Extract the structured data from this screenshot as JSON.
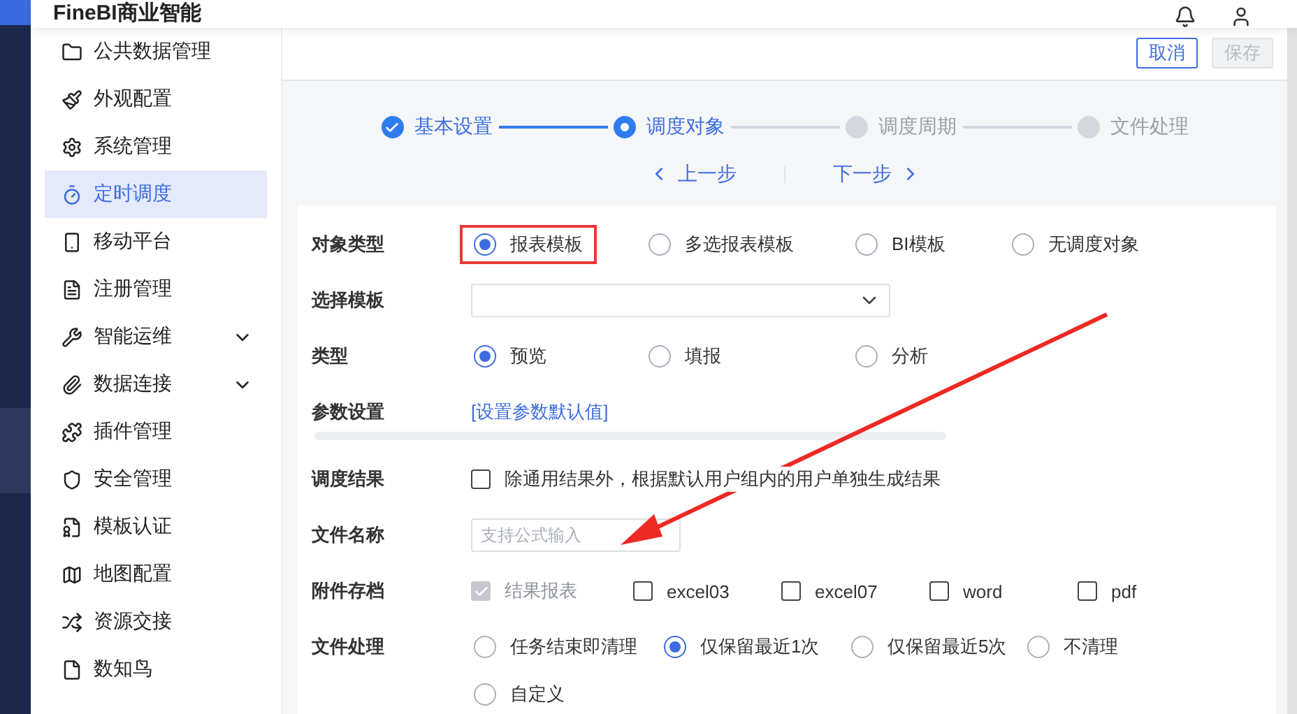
{
  "header": {
    "title": "FineBI商业智能"
  },
  "rail": [
    {
      "selected": false
    },
    {
      "selected": false
    },
    {
      "selected": true
    },
    {
      "selected": false
    },
    {
      "selected": false
    }
  ],
  "sidebar": {
    "items": [
      {
        "label": "公共数据管理",
        "selected": false,
        "expandable": false
      },
      {
        "label": "外观配置",
        "selected": false,
        "expandable": false
      },
      {
        "label": "系统管理",
        "selected": false,
        "expandable": false
      },
      {
        "label": "定时调度",
        "selected": true,
        "expandable": false
      },
      {
        "label": "移动平台",
        "selected": false,
        "expandable": false
      },
      {
        "label": "注册管理",
        "selected": false,
        "expandable": false
      },
      {
        "label": "智能运维",
        "selected": false,
        "expandable": true
      },
      {
        "label": "数据连接",
        "selected": false,
        "expandable": true
      },
      {
        "label": "插件管理",
        "selected": false,
        "expandable": false
      },
      {
        "label": "安全管理",
        "selected": false,
        "expandable": false
      },
      {
        "label": "模板认证",
        "selected": false,
        "expandable": false
      },
      {
        "label": "地图配置",
        "selected": false,
        "expandable": false
      },
      {
        "label": "资源交接",
        "selected": false,
        "expandable": false
      },
      {
        "label": "数知鸟",
        "selected": false,
        "expandable": false
      }
    ]
  },
  "toolbar": {
    "buttons": [
      {
        "label": "取消",
        "disabled": false
      },
      {
        "label": "保存",
        "disabled": true
      }
    ]
  },
  "steps": [
    {
      "label": "基本设置",
      "completed": true
    },
    {
      "label": "调度对象",
      "completed": false
    },
    {
      "label": "调度周期",
      "completed": false
    },
    {
      "label": "文件处理",
      "completed": false
    }
  ],
  "nav": {
    "prev": "上一步",
    "next": "下一步"
  },
  "form": [
    {
      "kind": "radio",
      "label": "对象类型",
      "options": [
        {
          "label": "报表模板",
          "selected": true,
          "highlighted": true
        },
        {
          "label": "多选报表模板",
          "selected": false
        },
        {
          "label": "BI模板",
          "selected": false
        },
        {
          "label": "无调度对象",
          "selected": false
        }
      ]
    },
    {
      "kind": "select",
      "label": "选择模板"
    },
    {
      "kind": "radio",
      "label": "类型",
      "options": [
        {
          "label": "预览",
          "selected": true
        },
        {
          "label": "填报",
          "selected": false
        },
        {
          "label": "分析",
          "selected": false
        }
      ]
    },
    {
      "kind": "link",
      "label": "参数设置",
      "link": "[设置参数默认值]"
    },
    {
      "kind": "checks",
      "label": "调度结果",
      "options": [
        {
          "label": "除通用结果外，根据默认用户组内的用户单独生成结果",
          "checked": false,
          "disabled": false
        }
      ]
    },
    {
      "kind": "input",
      "label": "文件名称",
      "placeholder": "支持公式输入"
    },
    {
      "kind": "checks",
      "label": "附件存档",
      "options": [
        {
          "label": "结果报表",
          "checked": true,
          "disabled": true
        },
        {
          "label": "excel03",
          "checked": false,
          "disabled": false
        },
        {
          "label": "excel07",
          "checked": false,
          "disabled": false
        },
        {
          "label": "word",
          "checked": false,
          "disabled": false
        },
        {
          "label": "pdf",
          "checked": false,
          "disabled": false
        }
      ]
    },
    {
      "kind": "radio",
      "label": "文件处理",
      "options": [
        {
          "label": "任务结束即清理",
          "selected": false
        },
        {
          "label": "仅保留最近1次",
          "selected": true
        },
        {
          "label": "仅保留最近5次",
          "selected": false
        },
        {
          "label": "不清理",
          "selected": false
        },
        {
          "label": "自定义",
          "selected": false
        }
      ]
    }
  ]
}
